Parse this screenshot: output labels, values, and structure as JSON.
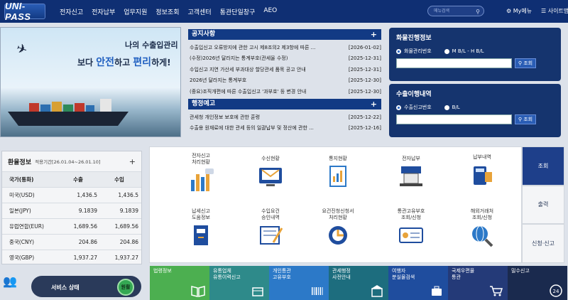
{
  "header": {
    "logo": "UNI-PASS",
    "nav": [
      "전자신고",
      "전자납부",
      "업무지원",
      "정보조회",
      "고객센터",
      "통관단일창구",
      "AEO"
    ],
    "search_placeholder": "메뉴검색",
    "my_menu": "My메뉴",
    "sitemap": "사이트맵"
  },
  "banner": {
    "line1": "나의 수출입관리",
    "line2_pre": "보다 ",
    "line2_hl1": "안전",
    "line2_mid": "하고 ",
    "line2_hl2": "편리",
    "line2_post": "하게!",
    "controls": [
      "‹",
      "||",
      "›"
    ]
  },
  "notices": {
    "title": "공지사항",
    "items": [
      {
        "text": "수출입신고 오류방지에 관한 고시 제8조의2 제3항에 따른 ...",
        "date": "[2026-01-02]"
      },
      {
        "text": "(수정)2026년 달라지는 통계부호(관세율 수정)",
        "date": "[2025-12-31]"
      },
      {
        "text": "수입신고 지연 가산세 부과대상 할당관세 품목 공고 안내",
        "date": "[2025-12-31]"
      },
      {
        "text": "2026년 달라지는 통계부호",
        "date": "[2025-12-30]"
      },
      {
        "text": "(중요)조직개편에 따른 수출입신고 '과부호' 등 변경 안내",
        "date": "[2025-12-30]"
      }
    ]
  },
  "admin_notices": {
    "title": "행정예고",
    "items": [
      {
        "text": "관세청 개인정보 보호에 관한 훈령",
        "date": "[2025-12-22]"
      },
      {
        "text": "수출용 원재료에 대한 관세 등의 일괄납부 및 정산에 관한 ...",
        "date": "[2025-12-16]"
      }
    ]
  },
  "cargo_track": {
    "title": "화물진행정보",
    "options": [
      "화물관리번호",
      "M B/L - H B/L"
    ],
    "button": "조회"
  },
  "export_track": {
    "title": "수출이행내역",
    "options": [
      "수출신고번호",
      "B/L"
    ],
    "button": "조회"
  },
  "exchange": {
    "title": "환율정보",
    "period": "적용기간[26.01.04~26.01.10]",
    "headers": [
      "국가(통화)",
      "수출",
      "수입"
    ],
    "rows": [
      {
        "country": "미국(USD)",
        "export": "1,436.5",
        "import": "1,436.5"
      },
      {
        "country": "일본(JPY)",
        "export": "9.1839",
        "import": "9.1839"
      },
      {
        "country": "유럽연합(EUR)",
        "export": "1,689.56",
        "import": "1,689.56"
      },
      {
        "country": "중국(CNY)",
        "export": "204.86",
        "import": "204.86"
      },
      {
        "country": "영국(GBP)",
        "export": "1,937.27",
        "import": "1,937.27"
      }
    ]
  },
  "service": {
    "label": "서비스 상태",
    "status": "원활"
  },
  "grid": {
    "items": [
      {
        "label": "전자신고\n처리현황",
        "icon": "bar-chart-icon"
      },
      {
        "label": "수신현황",
        "icon": "mail-monitor-icon"
      },
      {
        "label": "통지현황",
        "icon": "report-document-icon"
      },
      {
        "label": "전자납부",
        "icon": "payment-terminal-icon"
      },
      {
        "label": "납부내역",
        "icon": "calculator-icon"
      },
      {
        "label": "납세신고\n도움정보",
        "icon": "help-book-icon"
      },
      {
        "label": "수입요건\n승인내역",
        "icon": "approval-document-icon"
      },
      {
        "label": "요건진청신청서\n처리현황",
        "icon": "disc-status-icon"
      },
      {
        "label": "통관고유부호\n조회/신청",
        "icon": "id-card-icon"
      },
      {
        "label": "해외거래처\n조회/신청",
        "icon": "globe-search-icon"
      }
    ]
  },
  "tabs": [
    "조회",
    "출력",
    "신청·신고"
  ],
  "quick_links": [
    {
      "label": "법령정보",
      "icon": "book-icon"
    },
    {
      "label": "유통업체\n유통이력신고",
      "icon": "box-icon"
    },
    {
      "label": "개인통관\n고유부호",
      "icon": "barcode-icon"
    },
    {
      "label": "관세행정\n사전안내",
      "icon": "building-icon"
    },
    {
      "label": "여행자\n분실물검색",
      "icon": "suitcase-icon"
    },
    {
      "label": "국제우편물\n통관",
      "icon": "cart-icon"
    },
    {
      "label": "밀수신고",
      "icon": "phone-24-icon"
    }
  ],
  "colors": {
    "primary": "#123a84",
    "header": "#0f2f73",
    "active_tab": "#1e3f8a",
    "status_ok": "#34a853"
  }
}
